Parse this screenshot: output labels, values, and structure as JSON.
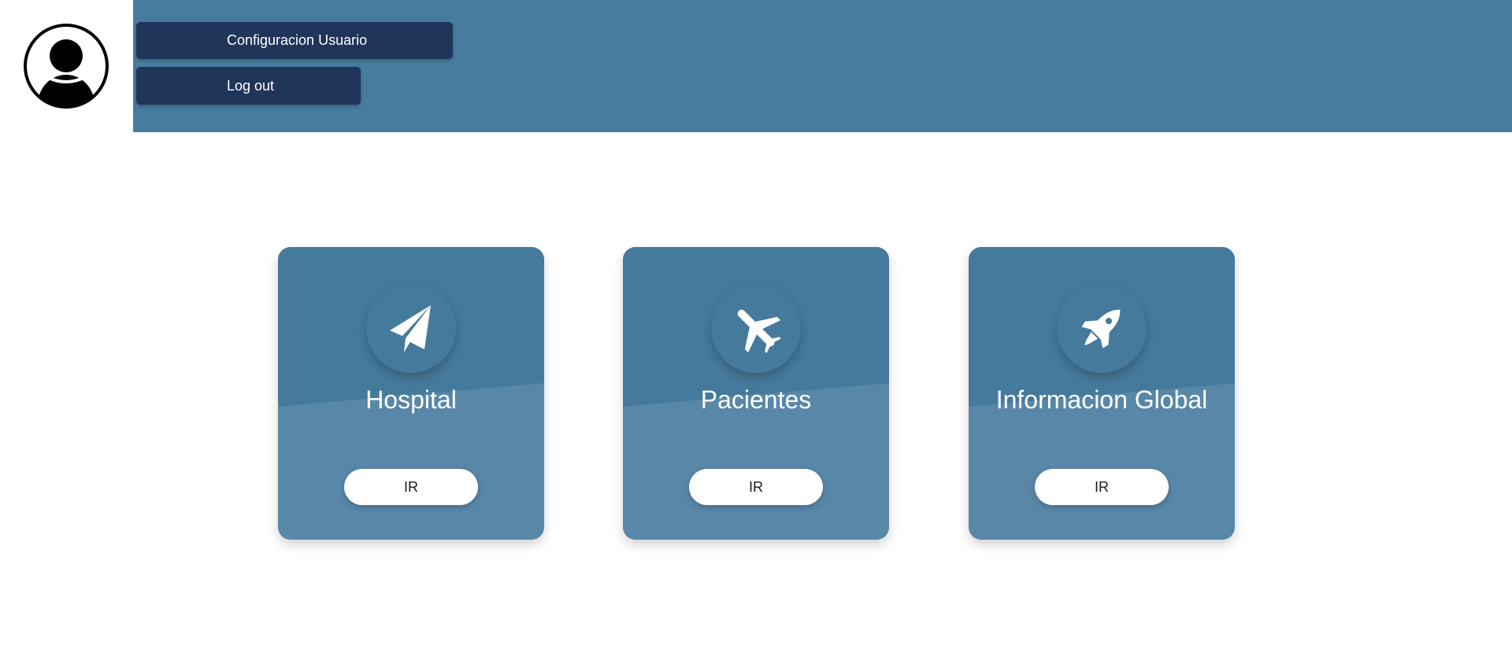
{
  "header": {
    "config_label": "Configuracion Usuario",
    "logout_label": "Log out"
  },
  "cards": [
    {
      "title": "Hospital",
      "icon": "paper-plane-icon",
      "button_label": "IR"
    },
    {
      "title": "Pacientes",
      "icon": "airplane-icon",
      "button_label": "IR"
    },
    {
      "title": "Informacion Global",
      "icon": "rocket-icon",
      "button_label": "IR"
    }
  ],
  "colors": {
    "header_bg": "#467c9e",
    "header_button_bg": "#1f3559",
    "card_top": "#457a9c",
    "card_bottom": "#5887a8"
  }
}
